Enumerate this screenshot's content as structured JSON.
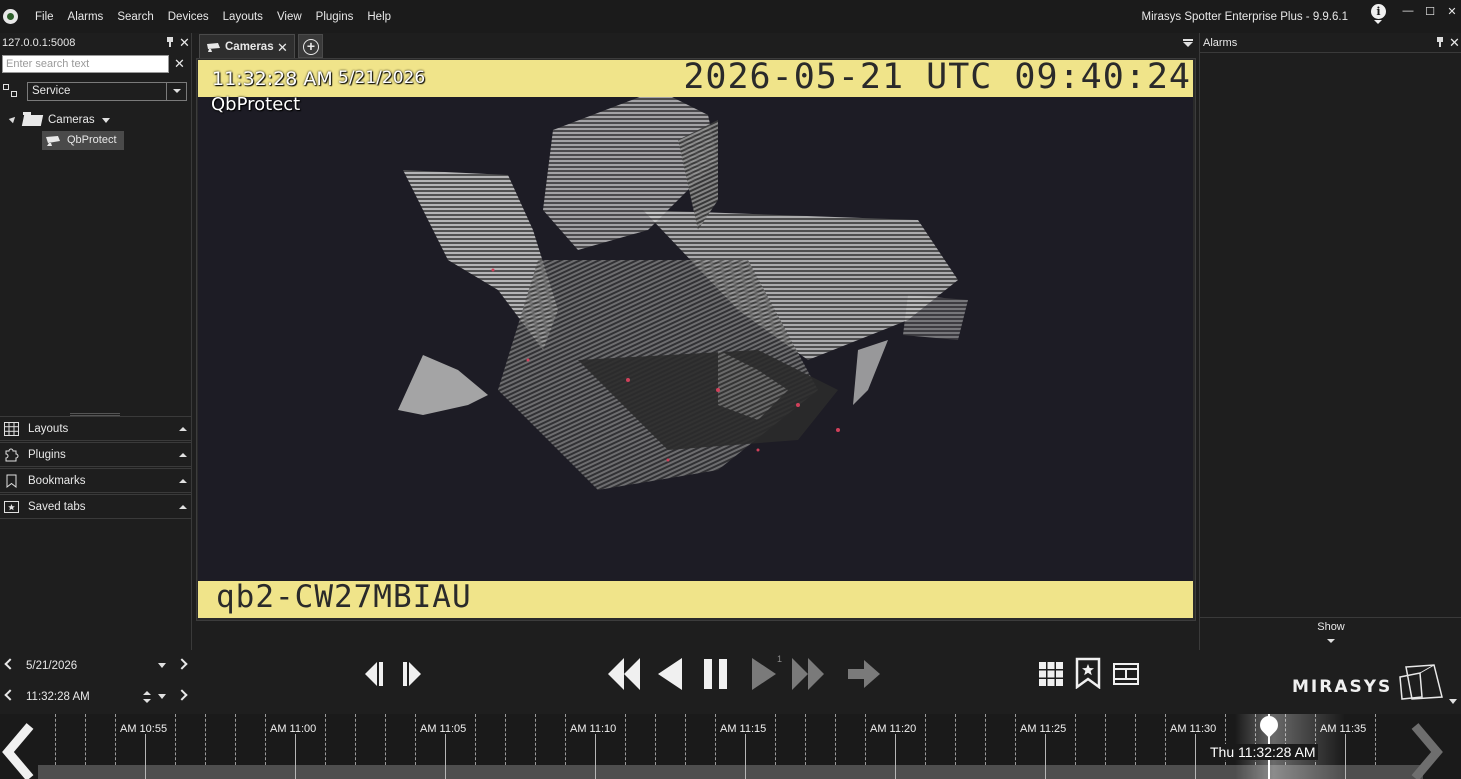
{
  "menu": [
    "File",
    "Alarms",
    "Search",
    "Devices",
    "Layouts",
    "View",
    "Plugins",
    "Help"
  ],
  "app_title": "Mirasys Spotter Enterprise Plus - 9.9.6.1",
  "window_controls": {
    "minimize": "—",
    "maximize": "☐",
    "close": "✕"
  },
  "left_panel": {
    "server_address": "127.0.0.1:5008",
    "search_placeholder": "Enter search text",
    "view_select": "Service",
    "tree": {
      "folder": "Cameras",
      "camera": "QbProtect"
    },
    "accordion": [
      {
        "label": "Layouts",
        "icon": "grid-icon"
      },
      {
        "label": "Plugins",
        "icon": "puzzle-icon"
      },
      {
        "label": "Bookmarks",
        "icon": "bookmark-icon"
      },
      {
        "label": "Saved tabs",
        "icon": "saved-tab-icon"
      }
    ]
  },
  "tabs": [
    {
      "label": "Cameras",
      "active": true
    }
  ],
  "video": {
    "osd_time": "11:32:28 AM",
    "osd_date": "5/21/2026",
    "camera_name": "QbProtect",
    "utc_timestamp": "2026-05-21 UTC 09:40:24",
    "device_id": "qb2-CW27MBIAU",
    "banner_color": "#f0e48a"
  },
  "right_panel": {
    "title": "Alarms",
    "show_label": "Show"
  },
  "bottom": {
    "date_value": "5/21/2026",
    "time_value": "11:32:28 AM",
    "speed_badge": "1",
    "brand": "MIRASYS"
  },
  "timeline": {
    "labels": [
      "AM 10:55",
      "AM 11:00",
      "AM 11:05",
      "AM 11:10",
      "AM 11:15",
      "AM 11:20",
      "AM 11:25",
      "AM 11:30",
      "AM 11:35"
    ],
    "cursor_label": "Thu 11:32:28 AM"
  },
  "colors": {
    "accent_banner": "#f0e48a",
    "background": "#1e1e1e",
    "selection": "#4a4a4a"
  }
}
